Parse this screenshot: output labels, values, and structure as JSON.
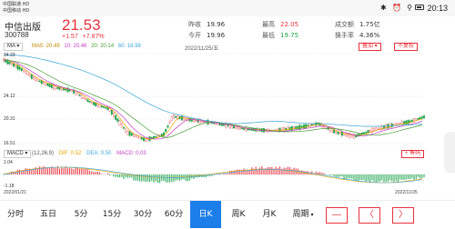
{
  "statusbar": {
    "carrier1": "中国联通 HD",
    "carrier2": "中国移动 HD",
    "time": "20:13",
    "icons": "✱ ⏰ ⚲"
  },
  "stock": {
    "name": "中信出版",
    "code": "300788",
    "price": "21.53",
    "change": "+1.57",
    "change_pct": "+7.87%",
    "stats": [
      {
        "label": "昨收",
        "value": "19.96"
      },
      {
        "label": "今开",
        "value": "19.96"
      },
      {
        "label": "最高",
        "value": "22.05"
      },
      {
        "label": "最低",
        "value": "19.75"
      },
      {
        "label": "成交额",
        "value": "1.75亿"
      },
      {
        "label": "换手率",
        "value": "4.36%"
      }
    ]
  },
  "toolbar": {
    "ma_button": "MA",
    "ma5": "MA5: 20.49",
    "ma10": "10: 20.46",
    "ma20": "20: 20.14",
    "ma60": "60: 18.98",
    "date": "2022/11/25/五",
    "overlay_button": "叠加",
    "adjust_button": "不复权"
  },
  "chart": {
    "y_labels": [
      "34.23",
      "24.12",
      "20.31",
      "16.51"
    ],
    "colors": {
      "up": "#e8323c",
      "down": "#1aa34a",
      "ma5": "#e6a500",
      "ma10": "#c040c0",
      "ma20": "#4a9e3a",
      "ma60": "#3aa4d8"
    }
  },
  "macd": {
    "button": "MACD",
    "params": "(12,26,9)",
    "dif": "DIF: 0.52",
    "dea": "DEA: 0.50",
    "macd": "MACD: 0.03",
    "chip_button": "筹码",
    "y_top": "1.04",
    "y_bottom": "-1.18",
    "start_date": "2022/01/21",
    "end_date": "2022/11/25"
  },
  "tabs": [
    "分时",
    "五日",
    "5分",
    "15分",
    "30分",
    "60分",
    "日K",
    "周K",
    "月K",
    "周期"
  ],
  "active_tab": "日K",
  "nav": {
    "minus": "—",
    "prev": "〈",
    "next": "〉"
  }
}
